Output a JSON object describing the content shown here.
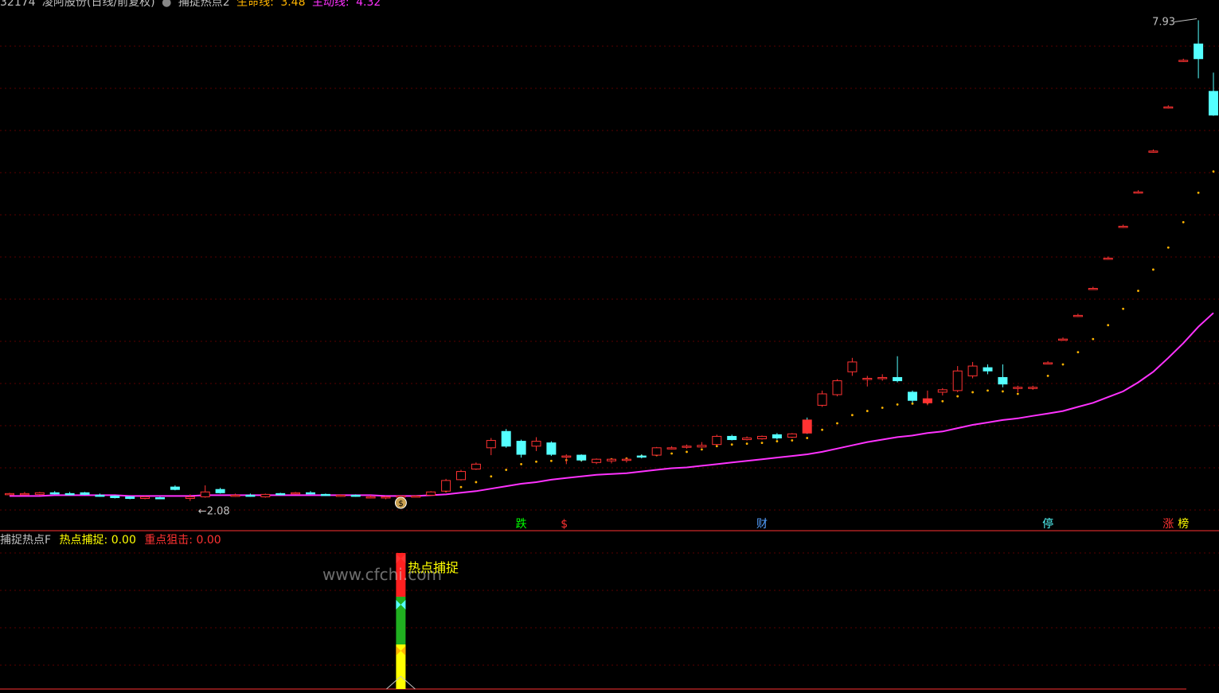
{
  "header": {
    "code": "32174",
    "name": "凌阿股份(日线/前复权)",
    "indicator": "捕捉热点2",
    "line1_label": "生命线:",
    "line1_value": "3.48",
    "line2_label": "主动线:",
    "line2_value": "4.32"
  },
  "indicator_panel": {
    "name": "捕捉热点F",
    "item1_label": "热点捕捉:",
    "item1_value": "0.00",
    "item2_label": "重点狙击:",
    "item2_value": "0.00",
    "signal_label": "热点捕捉",
    "watermark": "www.cfchi.com"
  },
  "colors": {
    "up": "#ff3232",
    "down": "#54ffff",
    "ma": "#ff32ff",
    "dots": "#ffb400",
    "grid": "#5a0000",
    "divider": "#ff3232"
  },
  "chart_data": {
    "type": "candlestick",
    "price_annotations": {
      "high": "7.93",
      "low": "2.08"
    },
    "ohlc": [
      [
        2.13,
        2.15,
        2.12,
        2.14
      ],
      [
        2.14,
        2.16,
        2.13,
        2.14
      ],
      [
        2.13,
        2.16,
        2.12,
        2.15
      ],
      [
        2.15,
        2.17,
        2.13,
        2.14
      ],
      [
        2.14,
        2.16,
        2.12,
        2.13
      ],
      [
        2.15,
        2.16,
        2.12,
        2.13
      ],
      [
        2.12,
        2.14,
        2.1,
        2.11
      ],
      [
        2.11,
        2.12,
        2.08,
        2.09
      ],
      [
        2.1,
        2.11,
        2.07,
        2.08
      ],
      [
        2.08,
        2.11,
        2.07,
        2.1
      ],
      [
        2.09,
        2.1,
        2.07,
        2.08
      ],
      [
        2.22,
        2.24,
        2.18,
        2.19
      ],
      [
        2.08,
        2.13,
        2.05,
        2.1
      ],
      [
        2.1,
        2.24,
        2.09,
        2.16
      ],
      [
        2.19,
        2.21,
        2.14,
        2.15
      ],
      [
        2.12,
        2.14,
        2.1,
        2.12
      ],
      [
        2.12,
        2.14,
        2.1,
        2.11
      ],
      [
        2.1,
        2.14,
        2.09,
        2.13
      ],
      [
        2.14,
        2.15,
        2.12,
        2.13
      ],
      [
        2.14,
        2.16,
        2.13,
        2.15
      ],
      [
        2.15,
        2.17,
        2.13,
        2.14
      ],
      [
        2.13,
        2.14,
        2.11,
        2.12
      ],
      [
        2.12,
        2.13,
        2.1,
        2.12
      ],
      [
        2.12,
        2.13,
        2.1,
        2.11
      ],
      [
        2.1,
        2.12,
        2.08,
        2.1
      ],
      [
        2.09,
        2.11,
        2.07,
        2.1
      ],
      [
        2.1,
        2.12,
        2.09,
        2.11
      ],
      [
        2.11,
        2.12,
        2.1,
        2.11
      ],
      [
        2.12,
        2.17,
        2.11,
        2.16
      ],
      [
        2.17,
        2.32,
        2.16,
        2.3
      ],
      [
        2.31,
        2.43,
        2.3,
        2.41
      ],
      [
        2.44,
        2.52,
        2.43,
        2.5
      ],
      [
        2.7,
        2.82,
        2.61,
        2.79
      ],
      [
        2.9,
        2.93,
        2.7,
        2.72
      ],
      [
        2.78,
        2.8,
        2.58,
        2.62
      ],
      [
        2.72,
        2.83,
        2.66,
        2.78
      ],
      [
        2.76,
        2.78,
        2.6,
        2.62
      ],
      [
        2.6,
        2.62,
        2.5,
        2.6
      ],
      [
        2.61,
        2.62,
        2.53,
        2.55
      ],
      [
        2.52,
        2.57,
        2.5,
        2.56
      ],
      [
        2.54,
        2.57,
        2.51,
        2.56
      ],
      [
        2.55,
        2.58,
        2.52,
        2.56
      ],
      [
        2.6,
        2.62,
        2.57,
        2.59
      ],
      [
        2.61,
        2.71,
        2.6,
        2.7
      ],
      [
        2.7,
        2.72,
        2.68,
        2.7
      ],
      [
        2.71,
        2.74,
        2.69,
        2.72
      ],
      [
        2.71,
        2.77,
        2.7,
        2.73
      ],
      [
        2.74,
        2.86,
        2.73,
        2.84
      ],
      [
        2.84,
        2.86,
        2.79,
        2.8
      ],
      [
        2.8,
        2.84,
        2.79,
        2.82
      ],
      [
        2.81,
        2.85,
        2.8,
        2.84
      ],
      [
        2.86,
        2.88,
        2.8,
        2.82
      ],
      [
        2.83,
        2.88,
        2.82,
        2.87
      ],
      [
        3.04,
        3.07,
        2.87,
        2.88
      ],
      [
        3.22,
        3.4,
        3.2,
        3.36
      ],
      [
        3.35,
        3.54,
        3.33,
        3.52
      ],
      [
        3.63,
        3.8,
        3.58,
        3.75
      ],
      [
        3.55,
        3.58,
        3.45,
        3.55
      ],
      [
        3.56,
        3.6,
        3.52,
        3.56
      ],
      [
        3.56,
        3.82,
        3.5,
        3.52
      ],
      [
        3.38,
        3.4,
        3.25,
        3.28
      ],
      [
        3.25,
        3.4,
        3.22,
        3.3
      ],
      [
        3.38,
        3.43,
        3.34,
        3.41
      ],
      [
        3.4,
        3.7,
        3.38,
        3.64
      ],
      [
        3.58,
        3.75,
        3.55,
        3.7
      ],
      [
        3.68,
        3.72,
        3.6,
        3.64
      ],
      [
        3.56,
        3.72,
        3.44,
        3.48
      ],
      [
        3.44,
        3.46,
        3.38,
        3.44
      ],
      [
        3.44,
        3.46,
        3.41,
        3.44
      ],
      [
        3.74,
        3.76,
        3.72,
        3.74
      ],
      [
        4.03,
        4.05,
        4.01,
        4.03
      ],
      [
        4.32,
        4.34,
        4.3,
        4.32
      ],
      [
        4.65,
        4.67,
        4.63,
        4.65
      ],
      [
        5.02,
        5.04,
        5.0,
        5.02
      ],
      [
        5.41,
        5.43,
        5.39,
        5.41
      ],
      [
        5.83,
        5.85,
        5.81,
        5.83
      ],
      [
        6.33,
        6.35,
        6.31,
        6.33
      ],
      [
        6.87,
        6.89,
        6.85,
        6.87
      ],
      [
        7.44,
        7.46,
        7.42,
        7.44
      ],
      [
        7.64,
        7.93,
        7.22,
        7.46
      ],
      [
        7.06,
        7.29,
        6.76,
        6.77
      ]
    ],
    "ma_line": [
      2.11,
      2.11,
      2.11,
      2.12,
      2.12,
      2.12,
      2.12,
      2.12,
      2.11,
      2.11,
      2.11,
      2.11,
      2.11,
      2.12,
      2.12,
      2.12,
      2.12,
      2.12,
      2.12,
      2.12,
      2.12,
      2.12,
      2.12,
      2.12,
      2.12,
      2.11,
      2.11,
      2.11,
      2.12,
      2.13,
      2.15,
      2.17,
      2.2,
      2.23,
      2.26,
      2.28,
      2.31,
      2.33,
      2.35,
      2.37,
      2.38,
      2.39,
      2.41,
      2.43,
      2.45,
      2.46,
      2.48,
      2.5,
      2.52,
      2.54,
      2.56,
      2.58,
      2.6,
      2.62,
      2.65,
      2.69,
      2.73,
      2.77,
      2.8,
      2.83,
      2.85,
      2.88,
      2.9,
      2.94,
      2.98,
      3.01,
      3.04,
      3.06,
      3.09,
      3.12,
      3.15,
      3.2,
      3.25,
      3.32,
      3.39,
      3.5,
      3.63,
      3.8,
      3.98,
      4.18,
      4.35
    ],
    "dot_line": [
      null,
      null,
      null,
      null,
      null,
      null,
      null,
      null,
      null,
      null,
      null,
      null,
      null,
      null,
      null,
      null,
      null,
      null,
      null,
      null,
      null,
      null,
      null,
      null,
      null,
      null,
      null,
      null,
      2.14,
      2.17,
      2.22,
      2.28,
      2.35,
      2.43,
      2.5,
      2.53,
      2.54,
      2.55,
      2.55,
      2.55,
      2.56,
      2.57,
      2.6,
      2.61,
      2.63,
      2.65,
      2.68,
      2.72,
      2.74,
      2.75,
      2.76,
      2.78,
      2.79,
      2.82,
      2.92,
      3.0,
      3.1,
      3.15,
      3.19,
      3.23,
      3.24,
      3.25,
      3.27,
      3.33,
      3.38,
      3.4,
      3.39,
      3.36,
      3.43,
      3.58,
      3.72,
      3.87,
      4.03,
      4.2,
      4.4,
      4.62,
      4.88,
      5.15,
      5.46,
      5.82,
      6.08
    ],
    "signal_marks": [
      {
        "index": 34,
        "text": "跌",
        "color": "#00ff00"
      },
      {
        "index": 37,
        "text": "$",
        "color": "#ff3232"
      },
      {
        "index": 50,
        "text": "财",
        "color": "#54a0ff"
      },
      {
        "index": 69,
        "text": "停",
        "color": "#54ffff"
      },
      {
        "index": 77,
        "text": "涨",
        "color": "#ff3232"
      },
      {
        "index": 78,
        "text": "榜",
        "color": "#ffff00"
      }
    ],
    "money_bag_index": 26,
    "indicator_signal_index": 26,
    "ylim": [
      1.9,
      8.1
    ],
    "grid": true
  }
}
